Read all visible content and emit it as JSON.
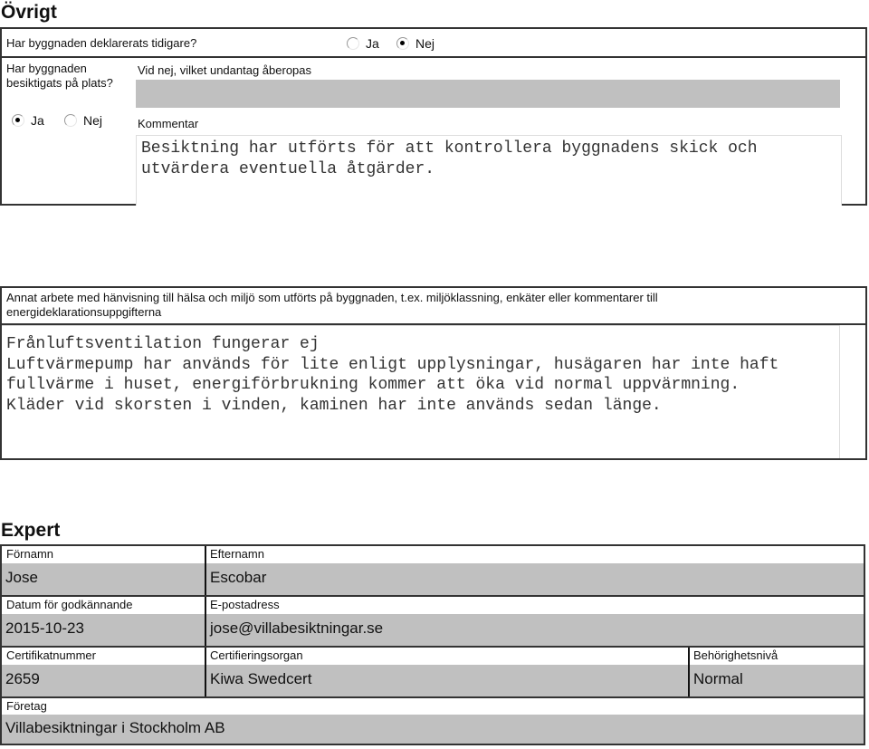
{
  "ovrigt": {
    "heading": "Övrigt",
    "declared_question": "Har byggnaden deklarerats tidigare?",
    "declared_options": [
      {
        "label": "Ja",
        "selected": false
      },
      {
        "label": "Nej",
        "selected": true
      }
    ],
    "inspected_question": "Har byggnaden besiktigats på plats?",
    "inspected_options": [
      {
        "label": "Ja",
        "selected": true
      },
      {
        "label": "Nej",
        "selected": false
      }
    ],
    "exception_label": "Vid nej, vilket undantag åberopas",
    "exception_value": "",
    "comment_label": "Kommentar",
    "comment_value": "Besiktning har utförts för att kontrollera byggnadens skick och utvärdera eventuella åtgärder."
  },
  "other_work": {
    "label": "Annat arbete med hänvisning till hälsa och miljö som utförts på byggnaden, t.ex. miljöklassning, enkäter eller kommentarer till energideklarationsuppgifterna",
    "value": "Frånluftsventilation fungerar ej\nLuftvärmepump har används för lite enligt upplysningar, husägaren har inte haft fullvärme i huset, energiförbrukning kommer att öka vid normal uppvärmning.\nKläder vid skorsten i vinden, kaminen har inte används sedan länge."
  },
  "expert": {
    "heading": "Expert",
    "first_name": {
      "label": "Förnamn",
      "value": "Jose"
    },
    "last_name": {
      "label": "Efternamn",
      "value": "Escobar"
    },
    "approval_date": {
      "label": "Datum för godkännande",
      "value": "2015-10-23"
    },
    "email": {
      "label": "E-postadress",
      "value": "jose@villabesiktningar.se"
    },
    "cert_number": {
      "label": "Certifikatnummer",
      "value": "2659"
    },
    "cert_body": {
      "label": "Certifieringsorgan",
      "value": "Kiwa Swedcert"
    },
    "level": {
      "label": "Behörighetsnivå",
      "value": "Normal"
    },
    "company": {
      "label": "Företag",
      "value": "Villabesiktningar i Stockholm AB"
    }
  }
}
